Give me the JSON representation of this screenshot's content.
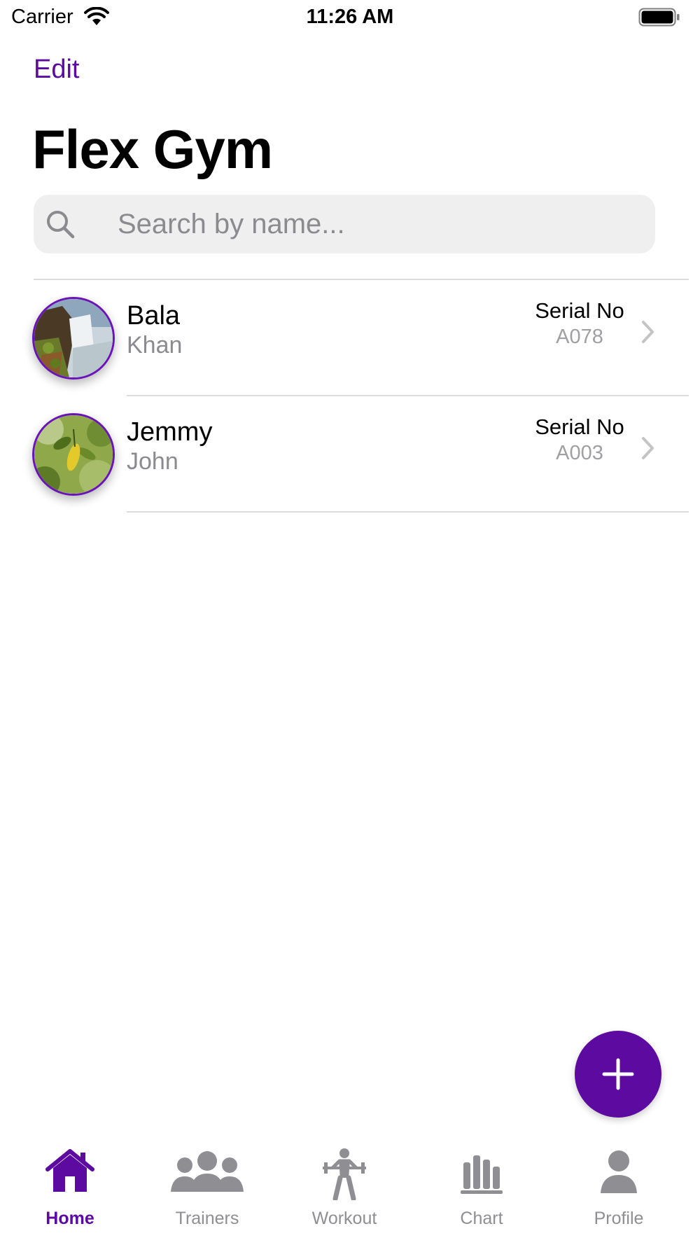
{
  "status_bar": {
    "carrier": "Carrier",
    "time": "11:26 AM"
  },
  "nav": {
    "edit_label": "Edit",
    "title": "Flex Gym"
  },
  "search": {
    "placeholder": "Search by name...",
    "value": ""
  },
  "members": [
    {
      "first_name": "Bala",
      "last_name": "Khan",
      "serial_label": "Serial No",
      "serial_value": "A078",
      "avatar": "waterfall-photo"
    },
    {
      "first_name": "Jemmy",
      "last_name": "John",
      "serial_label": "Serial No",
      "serial_value": "A003",
      "avatar": "leaf-photo"
    }
  ],
  "fab": {
    "icon": "plus-icon"
  },
  "tabs": [
    {
      "label": "Home",
      "icon": "home-icon",
      "active": true
    },
    {
      "label": "Trainers",
      "icon": "trainers-icon",
      "active": false
    },
    {
      "label": "Workout",
      "icon": "workout-icon",
      "active": false
    },
    {
      "label": "Chart",
      "icon": "chart-icon",
      "active": false
    },
    {
      "label": "Profile",
      "icon": "profile-icon",
      "active": false
    }
  ],
  "colors": {
    "accent": "#5c0aa0",
    "inactive": "#8e8e93",
    "search_bg": "#efeff0",
    "separator": "#dcdcdf"
  }
}
